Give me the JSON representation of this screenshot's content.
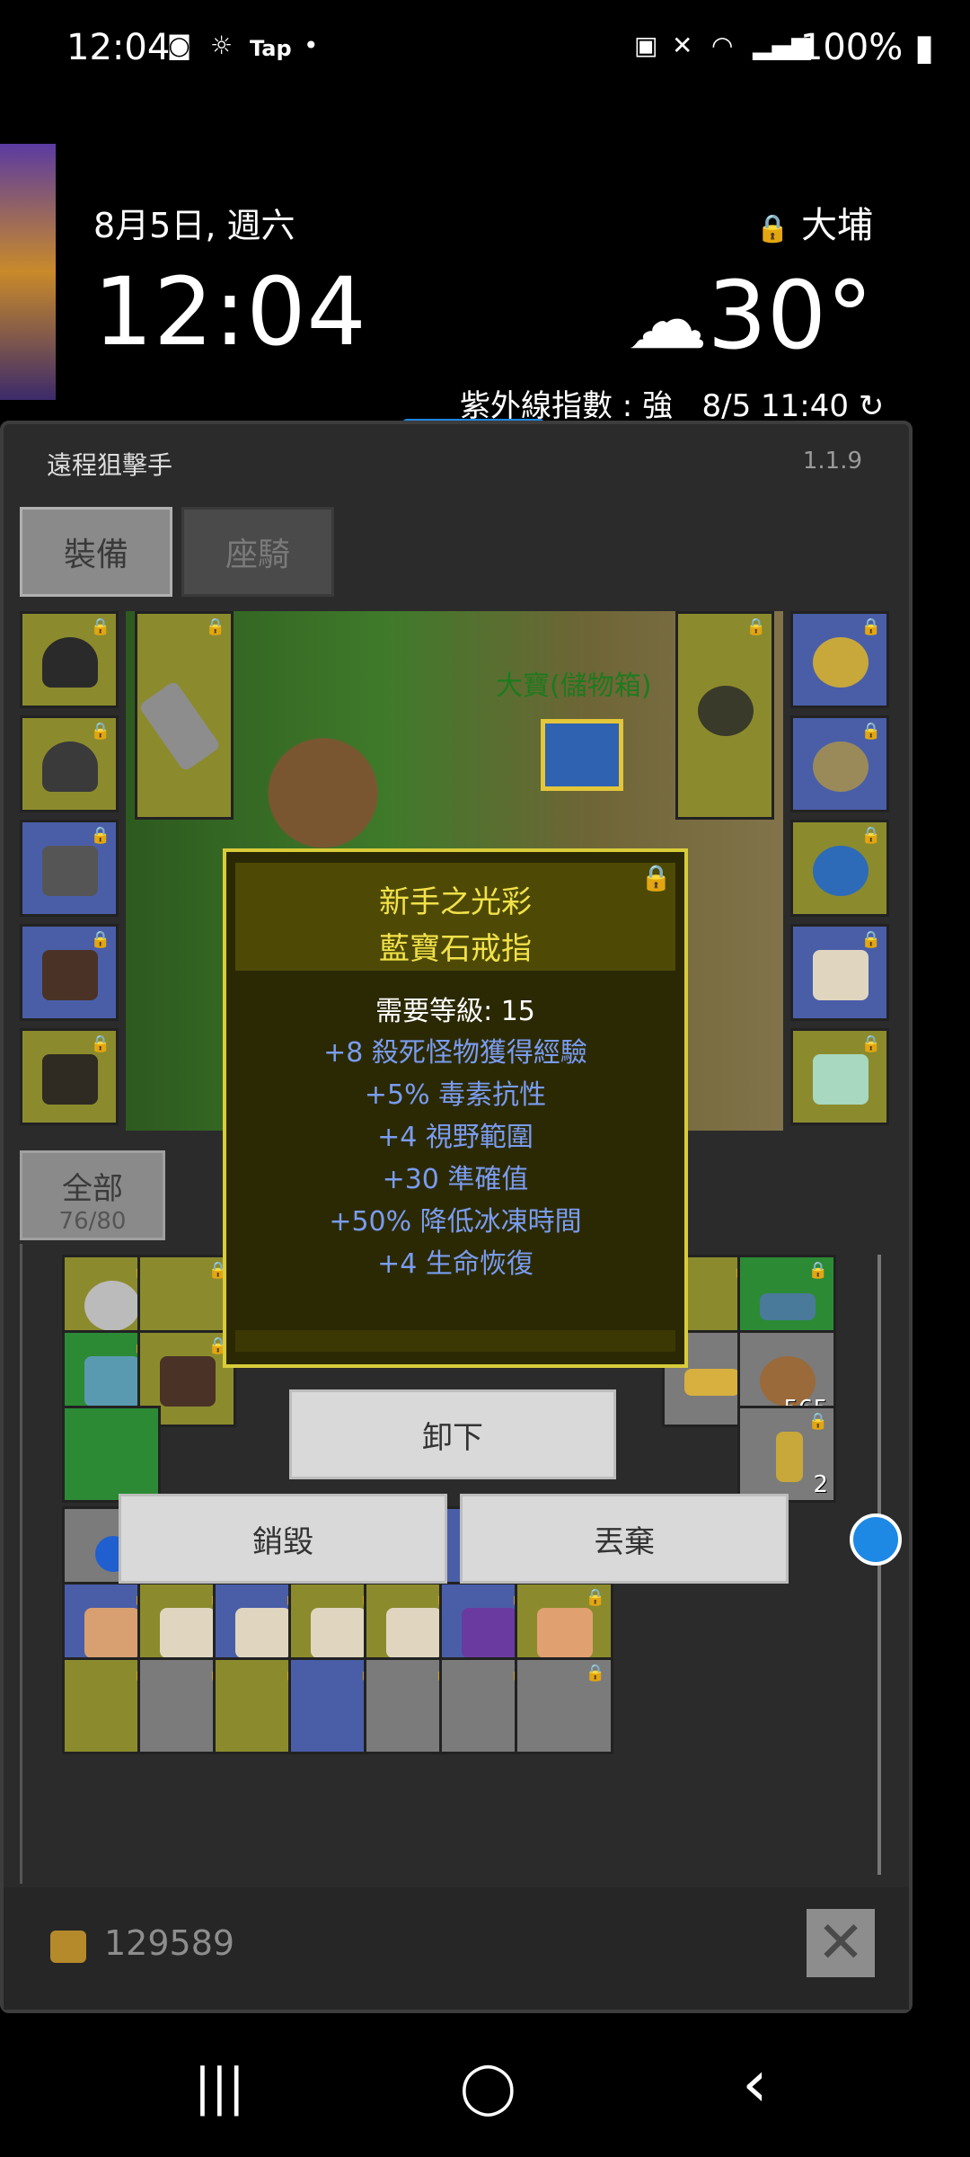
{
  "status_bar": {
    "time": "12:04",
    "app_badge": "Tap",
    "battery": "100%"
  },
  "lockscreen": {
    "date": "8月5日, 週六",
    "clock": "12:04",
    "location": "大埔",
    "temperature": "30°",
    "uv_text": "紫外線指數 : 強",
    "updated": "8/5 11:40"
  },
  "game": {
    "title": "遠程狙擊手",
    "version": "1.1.9",
    "tabs": [
      {
        "label": "裝備"
      },
      {
        "label": "座騎"
      }
    ],
    "chest_label": "大寶(儲物箱)",
    "category": {
      "label": "全部",
      "count": "76/80"
    },
    "popup": {
      "name_line1": "新手之光彩",
      "name_line2": "藍寶石戒指",
      "requirement": "需要等級: 15",
      "stats": [
        "+8 殺死怪物獲得經驗",
        "+5% 毒素抗性",
        "+4 視野範圍",
        "+30 準確值",
        "+50% 降低冰凍時間",
        "+4 生命恢復"
      ]
    },
    "actions": {
      "unequip": "卸下",
      "destroy": "銷毀",
      "discard": "丟棄"
    },
    "inventory_quantities": {
      "ore": "2",
      "leather": "565",
      "gem_blue": "2",
      "potion": "2"
    },
    "gold": "129589",
    "close": "✕"
  },
  "icons": {
    "lock": "🔒",
    "cloud": "☁",
    "refresh": "↻",
    "nav_recent": "|||",
    "nav_home": "◯",
    "nav_back": "‹"
  },
  "colors": {
    "popup_title": "#f2e24a",
    "popup_stat": "#7a9cf0",
    "slot_yellow": "#8b8b2e",
    "slot_blue": "#4a5ea8",
    "slot_green": "#2c8a35"
  }
}
